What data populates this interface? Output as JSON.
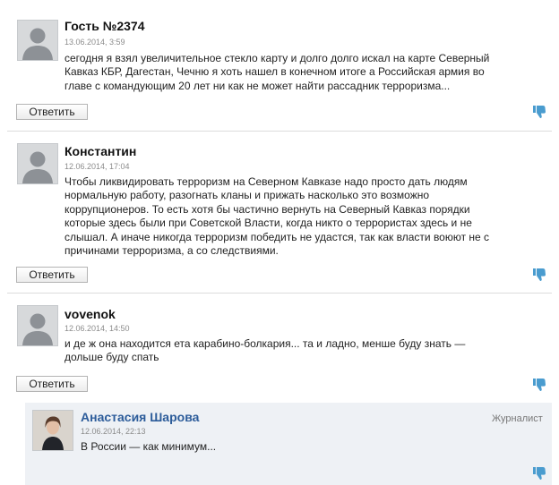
{
  "comments": [
    {
      "author": "Гость №2374",
      "date": "13.06.2014, 3:59",
      "text_lines": [
        "сегодня я взял увеличительное стекло карту и долго долго искал на карте Северный",
        "Кавказ КБР, Дагестан, Чечню я хоть нашел в конечном итоге а Российская армия во",
        "главе с командующим 20 лет ни как не может найти рассадник терроризма..."
      ],
      "reply_label": "Ответить"
    },
    {
      "author": "Константин",
      "date": "12.06.2014, 17:04",
      "text_lines": [
        "Чтобы ликвидировать терроризм на Северном Кавказе надо просто дать людям",
        "нормальную работу, разогнать кланы и прижать насколько это возможно",
        "коррупционеров. То есть хотя бы частично вернуть на Северный Кавказ порядки",
        "которые здесь были при Советской Власти, когда никто о террористах здесь и не",
        "слышал. А иначе никогда терроризм победить не удастся, так как власти воюют не с",
        "причинами терроризма, а со следствиями."
      ],
      "reply_label": "Ответить"
    },
    {
      "author": "vovenok",
      "date": "12.06.2014, 14:50",
      "text_lines": [
        "и де ж она находится ета карабино-болкария... та и ладно, менше буду знать —",
        "дольше буду спать"
      ],
      "reply_label": "Ответить"
    }
  ],
  "reply": {
    "author": "Анастасия Шарова",
    "date": "12.06.2014, 22:13",
    "role": "Журналист",
    "text": "В России — как минимум..."
  },
  "icons": {
    "dislike": "thumbs-down-icon",
    "avatar": "default-user-avatar"
  },
  "colors": {
    "staff_author": "#2c5c9a",
    "reply_background": "#eef1f5",
    "dislike_icon": "#4a9ccf"
  }
}
